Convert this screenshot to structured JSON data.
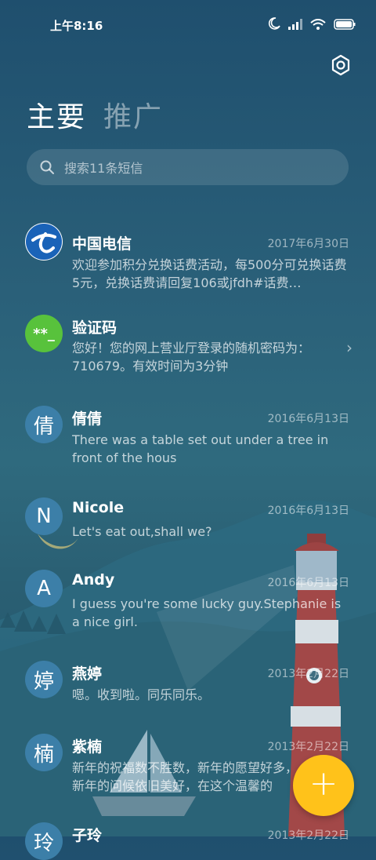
{
  "status_bar": {
    "time": "上午8:16",
    "icons": [
      "moon-icon",
      "signal-icon",
      "wifi-icon",
      "battery-icon"
    ]
  },
  "header": {
    "settings_icon": "gear-icon",
    "tabs": [
      {
        "label": "主要",
        "active": true
      },
      {
        "label": "推广",
        "active": false
      }
    ]
  },
  "search": {
    "placeholder": "搜索11条短信"
  },
  "conversations": [
    {
      "name": "中国电信",
      "avatar": "",
      "avatar_type": "logo",
      "date": "2017年6月30日",
      "preview": "欢迎参加积分兑换话费活动，每500分可兑换话费5元，兑换话费请回复106或jfdh#话费…"
    },
    {
      "name": "验证码",
      "avatar": "**_",
      "avatar_type": "code",
      "date": "",
      "preview": "您好！您的网上营业厅登录的随机密码为：710679。有效时间为3分钟"
    },
    {
      "name": "倩倩",
      "avatar": "倩",
      "date": "2016年6月13日",
      "preview": "There was a table set out under a tree in front of the hous"
    },
    {
      "name": "Nicole",
      "avatar": "N",
      "date": "2016年6月13日",
      "preview": "Let's eat out,shall we?"
    },
    {
      "name": "Andy",
      "avatar": "A",
      "date": "2016年6月13日",
      "preview": "I guess you're some lucky guy.Stephanie is a nice girl."
    },
    {
      "name": "燕婷",
      "avatar": "婷",
      "date": "2013年2月22日",
      "preview": "嗯。收到啦。同乐同乐。"
    },
    {
      "name": "紫楠",
      "avatar": "楠",
      "date": "2013年2月22日",
      "preview": "新年的祝福数不胜数，新年的愿望好多，新年的问候依旧美好，在这个温馨的"
    },
    {
      "name": "子玲",
      "avatar": "玲",
      "date": "2013年2月22日",
      "preview": ""
    }
  ],
  "fab": {
    "label": "+"
  },
  "colors": {
    "fab": "#ffc21a",
    "verify_avatar": "#58c23c",
    "logo_blue": "#1a63b8"
  }
}
